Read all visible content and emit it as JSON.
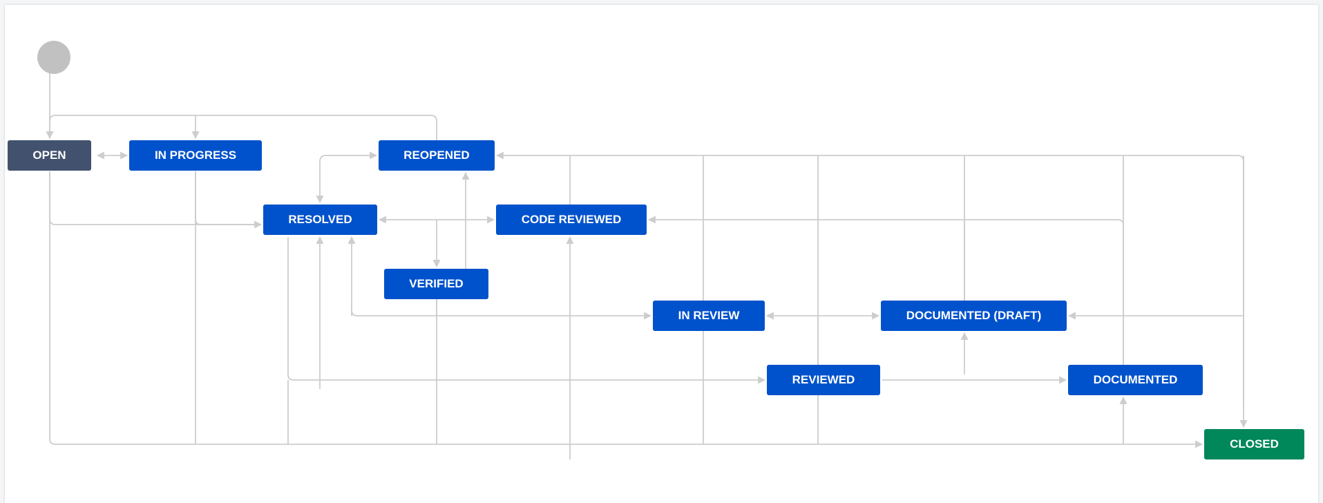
{
  "workflow": {
    "statuses": {
      "open": "OPEN",
      "in_progress": "IN PROGRESS",
      "reopened": "REOPENED",
      "resolved": "RESOLVED",
      "code_reviewed": "CODE REVIEWED",
      "verified": "VERIFIED",
      "in_review": "IN REVIEW",
      "documented_draft": "DOCUMENTED (DRAFT)",
      "reviewed": "REVIEWED",
      "documented": "DOCUMENTED",
      "closed": "CLOSED"
    },
    "colors": {
      "todo": "#42526e",
      "in_progress": "#0052cc",
      "done": "#00875a",
      "start": "#c1c1c1",
      "connector": "#cdcdcd"
    }
  }
}
